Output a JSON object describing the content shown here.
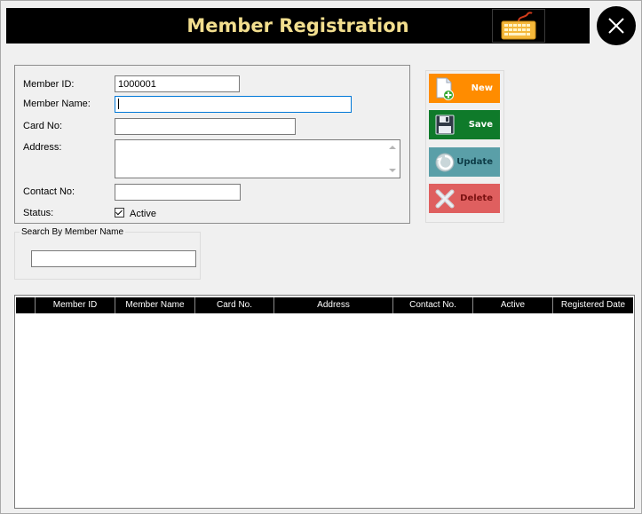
{
  "window": {
    "title": "Member Registration"
  },
  "form": {
    "member_id_label": "Member ID:",
    "member_id_value": "1000001",
    "member_name_label": "Member Name:",
    "member_name_value": "",
    "card_no_label": "Card No:",
    "card_no_value": "",
    "address_label": "Address:",
    "address_value": "",
    "contact_no_label": "Contact No:",
    "contact_no_value": "",
    "status_label": "Status:",
    "active_label": "Active",
    "active_checked": true
  },
  "actions": {
    "new_label": "New",
    "save_label": "Save",
    "update_label": "Update",
    "delete_label": "Delete"
  },
  "search": {
    "group_label": "Search By Member Name",
    "value": ""
  },
  "grid": {
    "columns": [
      "Member ID",
      "Member Name",
      "Card No.",
      "Address",
      "Contact No.",
      "Active",
      "Registered Date"
    ],
    "rows": []
  },
  "icons": {
    "keyboard": "keyboard-icon",
    "close": "close-icon",
    "new": "new-document-icon",
    "save": "floppy-disk-icon",
    "update": "refresh-icon",
    "delete": "delete-x-icon"
  },
  "colors": {
    "title_text": "#f2de8e",
    "new_button": "#ff8c00",
    "save_button": "#0f7a2a",
    "update_button": "#5a9fa8",
    "delete_button": "#df5f5f",
    "focus_border": "#0078d7"
  }
}
